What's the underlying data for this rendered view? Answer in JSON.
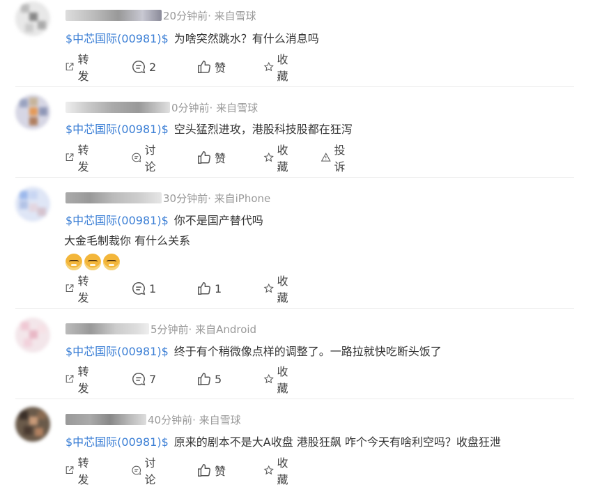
{
  "labels": {
    "repost": "转发",
    "discuss": "讨论",
    "like": "赞",
    "favorite": "收藏",
    "report": "投诉"
  },
  "icons": {
    "repost": "share-out-icon",
    "comment": "comment-bubble-icon",
    "like": "thumbs-up-icon",
    "favorite": "star-icon",
    "report": "warning-triangle-icon"
  },
  "colors": {
    "stock_link": "#3a7ed5",
    "meta_text": "#999999",
    "body_text": "#333333"
  },
  "posts": [
    {
      "meta": "20分钟前· 来自雪球",
      "stock": "$中芯国际(00981)$",
      "text": "为啥突然跳水？有什么消息吗",
      "extra": "",
      "comment_label": "2",
      "like_label": "赞"
    },
    {
      "meta": "0分钟前· 来自雪球",
      "stock": "$中芯国际(00981)$",
      "text": "空头猛烈进攻，港股科技股都在狂泻",
      "extra": "",
      "comment_label": "讨论",
      "like_label": "赞"
    },
    {
      "meta": "30分钟前· 来自iPhone",
      "stock": "$中芯国际(00981)$",
      "text": "你不是国产替代吗",
      "extra": "大金毛制裁你 有什么关系",
      "comment_label": "1",
      "like_label": "1"
    },
    {
      "meta": "5分钟前· 来自Android",
      "stock": "$中芯国际(00981)$",
      "text": "终于有个稍微像点样的调整了。一路拉就快吃断头饭了",
      "extra": "",
      "comment_label": "7",
      "like_label": "5"
    },
    {
      "meta": "40分钟前· 来自雪球",
      "stock": "$中芯国际(00981)$",
      "text": "原来的剧本不是大A收盘 港股狂飙 咋个今天有啥利空吗？收盘狂泄",
      "extra": "",
      "comment_label": "讨论",
      "like_label": "赞"
    }
  ]
}
